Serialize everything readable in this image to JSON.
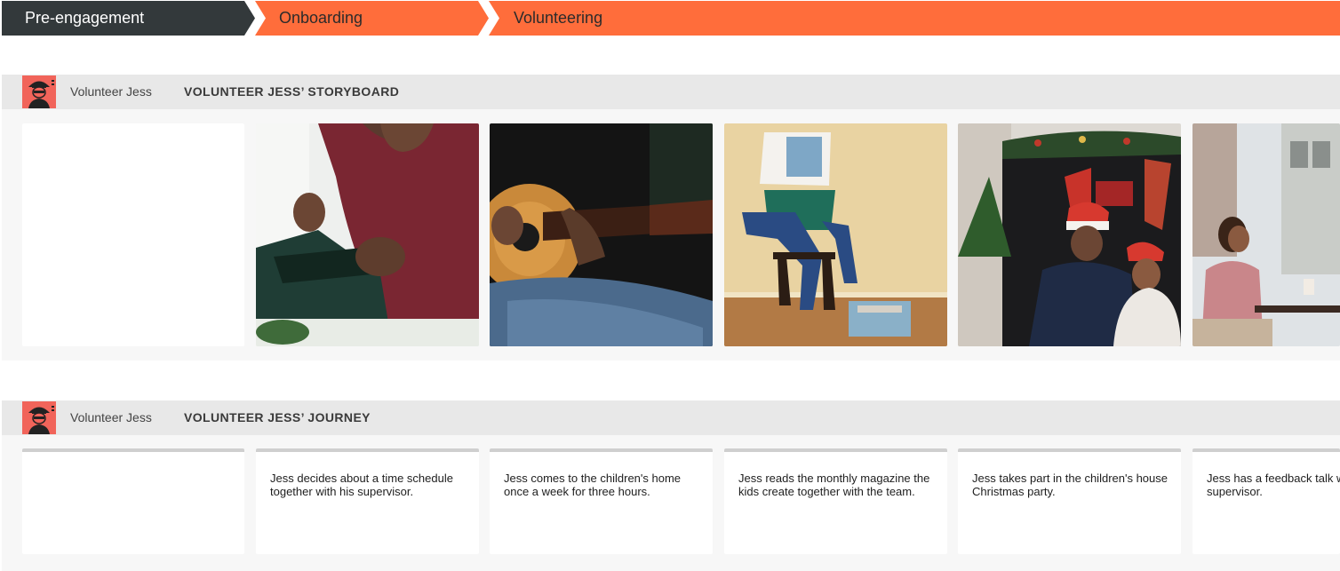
{
  "phases": [
    {
      "label": "Pre-engagement",
      "color": "#33393b"
    },
    {
      "label": "Onboarding",
      "color": "#ff6d3b"
    },
    {
      "label": "Volunteering",
      "color": "#ff6d3b"
    }
  ],
  "storyboard": {
    "persona": "Volunteer Jess",
    "title": "VOLUNTEER JESS’ STORYBOARD",
    "photos": [
      "man-writing-notebook-photo",
      "playing-guitar-photo",
      "reading-magazine-photo",
      "christmas-party-photo",
      "cafe-conversation-photo"
    ]
  },
  "journey": {
    "persona": "Volunteer Jess",
    "title": "VOLUNTEER JESS’ JOURNEY",
    "steps": [
      "Jess decides about a time schedule together with his supervisor.",
      "Jess comes to the children's home once a week for three hours.",
      "Jess reads the monthly magazine the kids create together with the team.",
      "Jess takes part in the children's house Christmas party.",
      "Jess has a feedback talk with his supervisor."
    ]
  },
  "icons": {
    "persona": "volunteer-avatar-icon"
  },
  "colors": {
    "accent": "#ff6d3b",
    "dark": "#33393b",
    "avatar_bg": "#f1645a",
    "header_bg": "#e8e8e8"
  }
}
